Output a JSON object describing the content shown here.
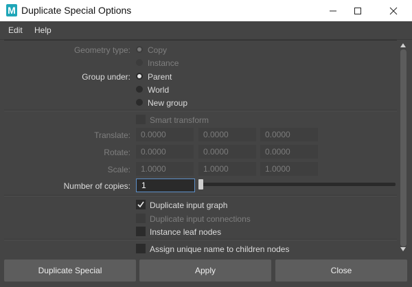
{
  "window": {
    "title": "Duplicate Special Options",
    "icon_letter": "M"
  },
  "menu": [
    "Edit",
    "Help"
  ],
  "geometry_type": {
    "label": "Geometry type:",
    "options": [
      "Copy",
      "Instance"
    ],
    "selected": "Copy"
  },
  "group_under": {
    "label": "Group under:",
    "options": [
      "Parent",
      "World",
      "New group"
    ],
    "selected": "Parent"
  },
  "smart_transform": {
    "label": "Smart transform",
    "checked": false
  },
  "transform": {
    "translate": {
      "label": "Translate:",
      "values": [
        "0.0000",
        "0.0000",
        "0.0000"
      ]
    },
    "rotate": {
      "label": "Rotate:",
      "values": [
        "0.0000",
        "0.0000",
        "0.0000"
      ]
    },
    "scale": {
      "label": "Scale:",
      "values": [
        "1.0000",
        "1.0000",
        "1.0000"
      ]
    }
  },
  "copies": {
    "label": "Number of copies:",
    "value": "1"
  },
  "options": {
    "duplicate_input_graph": {
      "label": "Duplicate input graph",
      "checked": true
    },
    "duplicate_input_connections": {
      "label": "Duplicate input connections",
      "checked": false
    },
    "instance_leaf_nodes": {
      "label": "Instance leaf nodes",
      "checked": false
    },
    "assign_unique_name": {
      "label": "Assign unique name to children nodes",
      "checked": false
    }
  },
  "buttons": {
    "duplicate_special": "Duplicate Special",
    "apply": "Apply",
    "close": "Close"
  },
  "colors": {
    "background": "#444444",
    "field_active_border": "#5e90c9",
    "app_icon": "#1fa6b8"
  }
}
